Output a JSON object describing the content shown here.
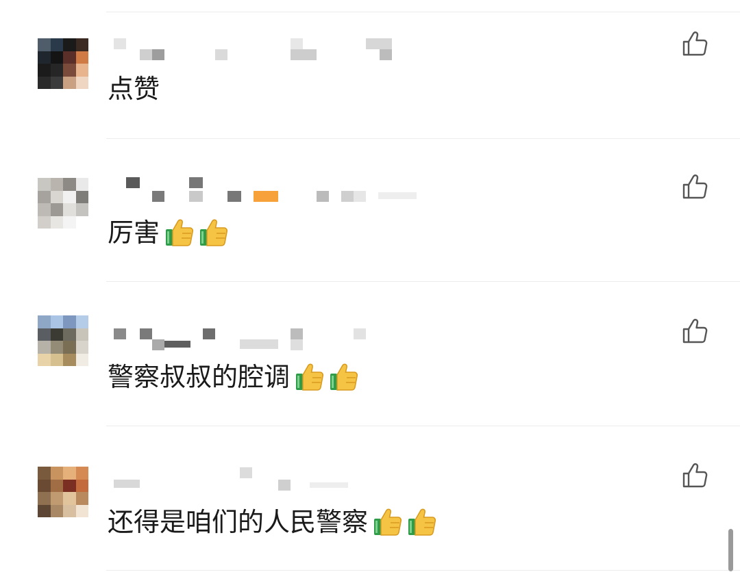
{
  "comments": [
    {
      "text": "点赞",
      "reactions": [],
      "avatar_colors": [
        "#4f5d6b",
        "#2b3a4a",
        "#1a1a1a",
        "#3a2a22",
        "#20262e",
        "#141414",
        "#5a2f2a",
        "#d07a45",
        "#1b1b1b",
        "#262626",
        "#7a4b3b",
        "#e8b48e",
        "#2a2a2a",
        "#3b3b3b",
        "#caa083",
        "#efd6c2"
      ],
      "name_color": "#d6d6d6"
    },
    {
      "text": "厉害",
      "reactions": [
        "thumbs-up",
        "thumbs-up"
      ],
      "avatar_colors": [
        "#c9c7c2",
        "#b9b5ae",
        "#8d8a85",
        "#e9e9e9",
        "#a6a39e",
        "#d9d6d1",
        "#f1f1f1",
        "#7f7d79",
        "#bdbab5",
        "#9c9994",
        "#e1dfdb",
        "#c5c3bf",
        "#d2cfcb",
        "#e8e6e3",
        "#f4f4f4",
        "#ffffff"
      ],
      "name_color": "#c8c8c8",
      "badge_color": "#f7a13a"
    },
    {
      "text": "警察叔叔的腔调",
      "reactions": [
        "thumbs-up",
        "thumbs-up"
      ],
      "avatar_colors": [
        "#8fa7c7",
        "#a9c4e5",
        "#7d97bf",
        "#b5cce8",
        "#5a5e62",
        "#3b3a33",
        "#6d6a60",
        "#c9c4b9",
        "#b7b2a8",
        "#958c77",
        "#7a6e55",
        "#d8d4cb",
        "#e8d2a8",
        "#d6c08f",
        "#a78d5d",
        "#f0ece4"
      ],
      "name_color": "#d0d0d0"
    },
    {
      "text": "还得是咱们的人民警察",
      "reactions": [
        "thumbs-up",
        "thumbs-up"
      ],
      "avatar_colors": [
        "#7a5a3d",
        "#c9935f",
        "#e6b07a",
        "#d48a52",
        "#6b4a33",
        "#a06d45",
        "#7b2f22",
        "#c46b3d",
        "#8f7050",
        "#c09b72",
        "#e2c49c",
        "#b88a5e",
        "#5e4634",
        "#a98865",
        "#d7bfa0",
        "#f1e4d2"
      ],
      "name_color": "#d0d0d0"
    }
  ]
}
